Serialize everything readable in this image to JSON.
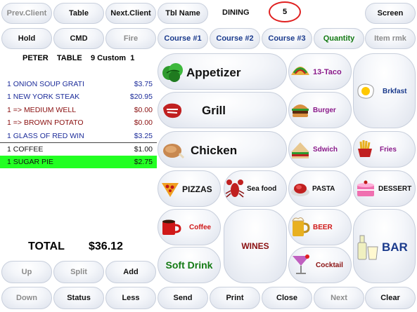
{
  "toolbar_top": {
    "prev_client": "Prev.Client",
    "table": "Table",
    "next_client": "Next.Client",
    "tbl_name": "Tbl Name",
    "dining": "DINING",
    "table_number": "5",
    "screen": "Screen"
  },
  "toolbar_second": {
    "hold": "Hold",
    "cmd": "CMD",
    "fire": "Fire",
    "course1": "Course #1",
    "course2": "Course #2",
    "course3": "Course #3",
    "quantity": "Quantity",
    "item_rmk": "Item rmk"
  },
  "order": {
    "header": "PETER    TABLE    9 Custom  1",
    "items": [
      {
        "label": "1 ONION SOUP GRATI",
        "price": "$3.75"
      },
      {
        "label": "1 NEW YORK STEAK",
        "price": "$20.95"
      },
      {
        "label": "1 => MEDIUM WELL",
        "price": "$0.00"
      },
      {
        "label": "1 => BROWN POTATO",
        "price": "$0.00"
      },
      {
        "label": "1 GLASS OF RED WIN",
        "price": "$3.25"
      },
      {
        "label": "1 COFFEE",
        "price": "$1.00"
      },
      {
        "label": "1 SUGAR PIE",
        "price": "$2.75"
      }
    ],
    "total_label": "TOTAL",
    "total_value": "$36.12"
  },
  "left_buttons": {
    "up": "Up",
    "split": "Split",
    "add": "Add",
    "down": "Down",
    "status": "Status",
    "less": "Less"
  },
  "categories": {
    "appetizer": "Appetizer",
    "grill": "Grill",
    "chicken": "Chicken",
    "pizzas": "PIZZAS",
    "seafood": "Sea food",
    "coffee": "Coffee",
    "soft_drink": "Soft Drink",
    "wines": "WINES",
    "taco": "13-Taco",
    "burger": "Burger",
    "sdwich": "Sdwich",
    "pasta": "PASTA",
    "beer": "BEER",
    "cocktail": "Cocktail",
    "brkfast": "Brkfast",
    "fries": "Fries",
    "dessert": "DESSERT",
    "bar": "BAR"
  },
  "bottom_bar": {
    "send": "Send",
    "print": "Print",
    "close": "Close",
    "next": "Next",
    "clear": "Clear"
  },
  "colors": {
    "selected_row": "#22ff22",
    "highlight_circle": "#e02020",
    "navy_text": "#1a3a8c",
    "green_text": "#137a13",
    "purple_text": "#8a1a8a",
    "dark_red_text": "#8a1010"
  }
}
